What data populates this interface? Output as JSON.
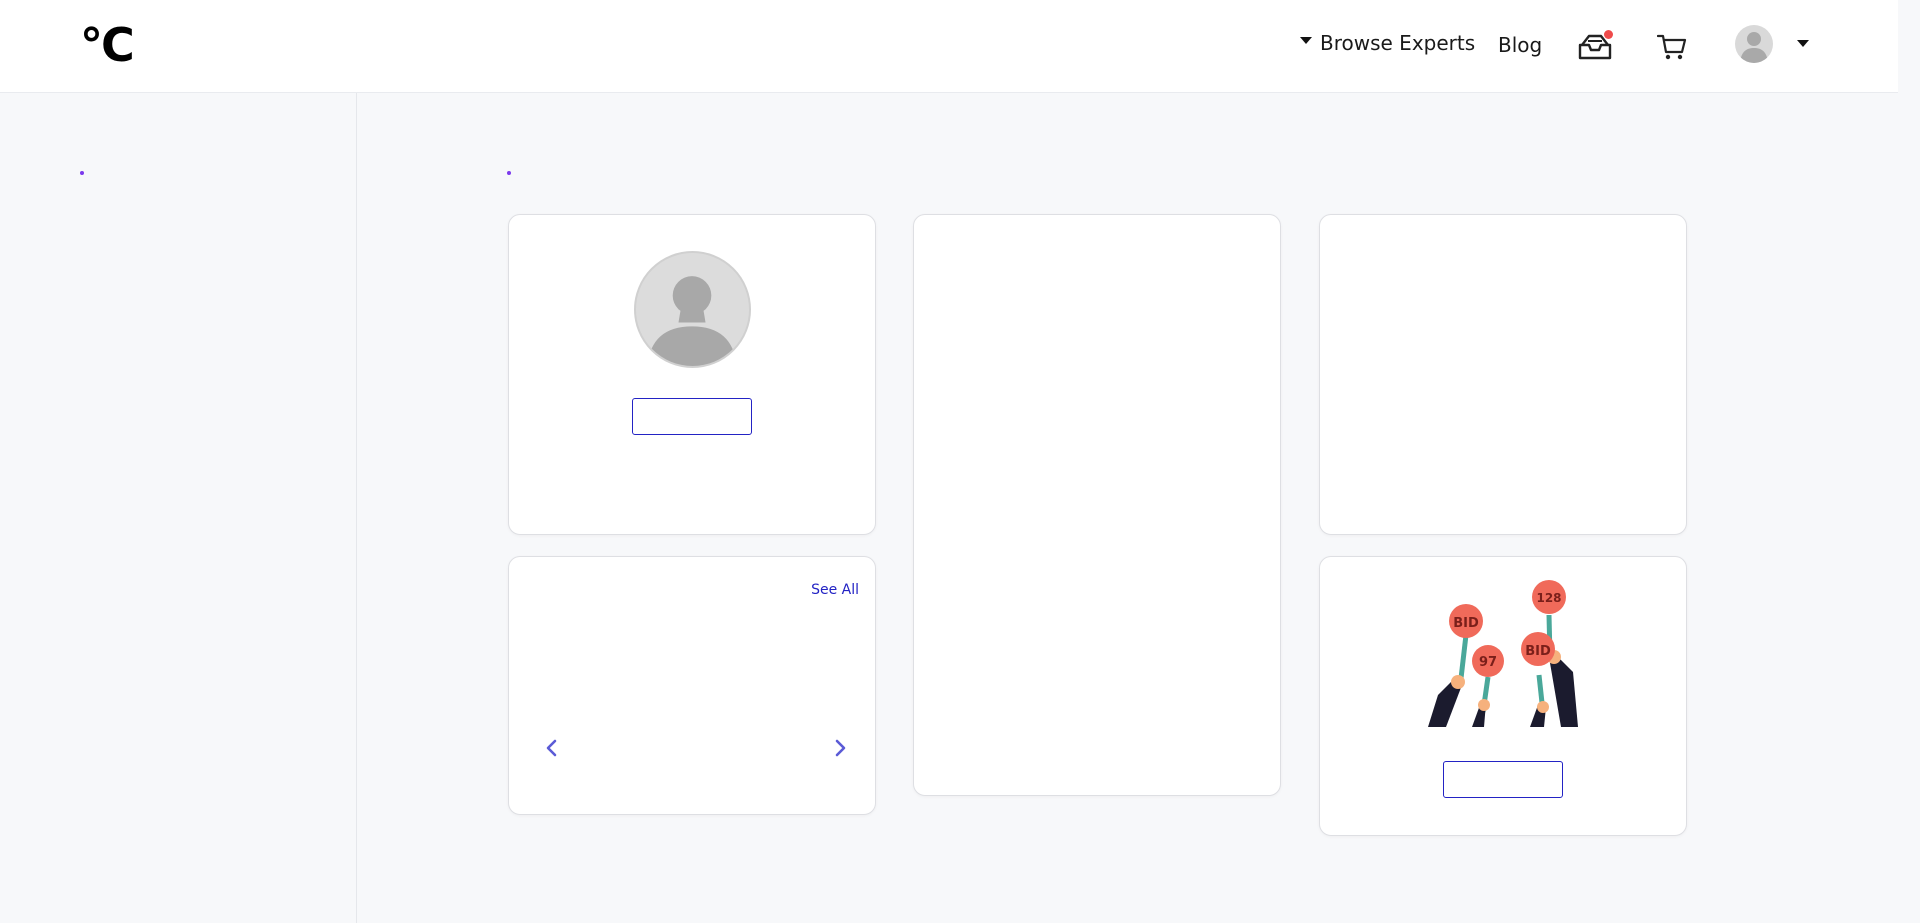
{
  "header": {
    "logo": "°C",
    "nav": {
      "browse_experts": "Browse Experts",
      "blog": "Blog"
    },
    "icons": {
      "inbox": "inbox-tray-icon",
      "cart": "shopping-cart-icon",
      "avatar": "user-avatar-icon",
      "dropdown": "caret-down-icon"
    },
    "notification_color": "#ef4b4b"
  },
  "carousel": {
    "see_all": "See All"
  },
  "bid_card": {
    "sign_labels": [
      "BID",
      "97",
      "128",
      "BID"
    ]
  },
  "colors": {
    "accent": "#2323c4",
    "dot": "#7c3aed",
    "page_bg": "#f7f8fa",
    "carousel_arrow": "#5b5bd6"
  }
}
